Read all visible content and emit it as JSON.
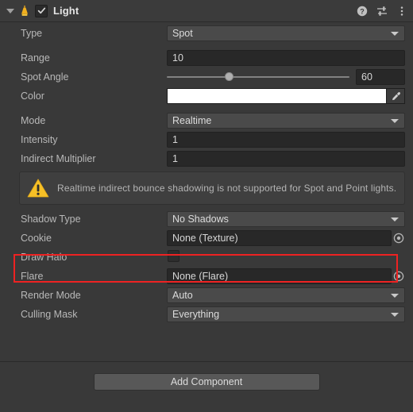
{
  "component": {
    "title": "Light",
    "enabled_checkbox": true,
    "foldout_expanded": true,
    "icon": "light-bulb-icon",
    "header_icons": [
      "help-icon",
      "preset-icon",
      "more-menu-icon"
    ]
  },
  "properties": {
    "type": {
      "label": "Type",
      "value": "Spot",
      "control": "dropdown"
    },
    "range": {
      "label": "Range",
      "value": "10",
      "control": "textfield"
    },
    "spot_angle": {
      "label": "Spot Angle",
      "value": "60",
      "control": "slider",
      "slider_percent": 34
    },
    "color": {
      "label": "Color",
      "value": "#FFFFFF",
      "control": "colorfield"
    },
    "mode": {
      "label": "Mode",
      "value": "Realtime",
      "control": "dropdown"
    },
    "intensity": {
      "label": "Intensity",
      "value": "1",
      "control": "textfield"
    },
    "indirect_multiplier": {
      "label": "Indirect Multiplier",
      "value": "1",
      "control": "textfield"
    },
    "shadow_type": {
      "label": "Shadow Type",
      "value": "No Shadows",
      "control": "dropdown"
    },
    "cookie": {
      "label": "Cookie",
      "value": "None (Texture)",
      "control": "objectfield"
    },
    "draw_halo": {
      "label": "Draw Halo",
      "value": false,
      "control": "checkbox"
    },
    "flare": {
      "label": "Flare",
      "value": "None (Flare)",
      "control": "objectfield"
    },
    "render_mode": {
      "label": "Render Mode",
      "value": "Auto",
      "control": "dropdown"
    },
    "culling_mask": {
      "label": "Culling Mask",
      "value": "Everything",
      "control": "dropdown"
    }
  },
  "warning": {
    "icon": "warning-triangle-icon",
    "text": "Realtime indirect bounce shadowing is not supported for Spot and Point lights."
  },
  "footer": {
    "add_component_label": "Add Component"
  },
  "annotation": {
    "target": "cookie-row",
    "color": "#EE2222"
  },
  "colors": {
    "background": "#393939",
    "header": "#3B3B3B",
    "field_dark": "#282828",
    "popup": "#4A4A4A",
    "accent_warning": "#FFC107",
    "text": "#B8B8B8",
    "annotation": "#EE2222"
  }
}
